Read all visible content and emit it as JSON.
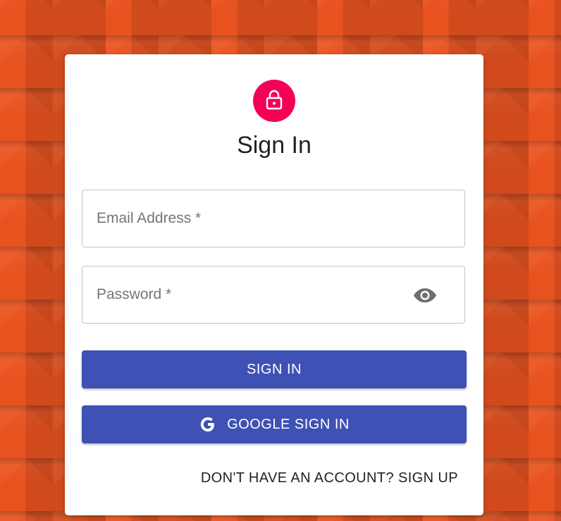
{
  "page": {
    "title": "Sign In"
  },
  "form": {
    "email_label": "Email Address *",
    "email_value": "",
    "password_label": "Password *",
    "password_value": ""
  },
  "buttons": {
    "sign_in": "SIGN IN",
    "google_sign_in": "GOOGLE SIGN IN"
  },
  "links": {
    "sign_up": "DON'T HAVE AN ACCOUNT? SIGN UP"
  },
  "icons": {
    "avatar": "lock-icon",
    "password_toggle": "eye-icon",
    "google": "google-icon"
  },
  "colors": {
    "background": "#e8521f",
    "avatar_bg": "#f50057",
    "primary_button": "#3f51b5",
    "card": "#ffffff"
  }
}
